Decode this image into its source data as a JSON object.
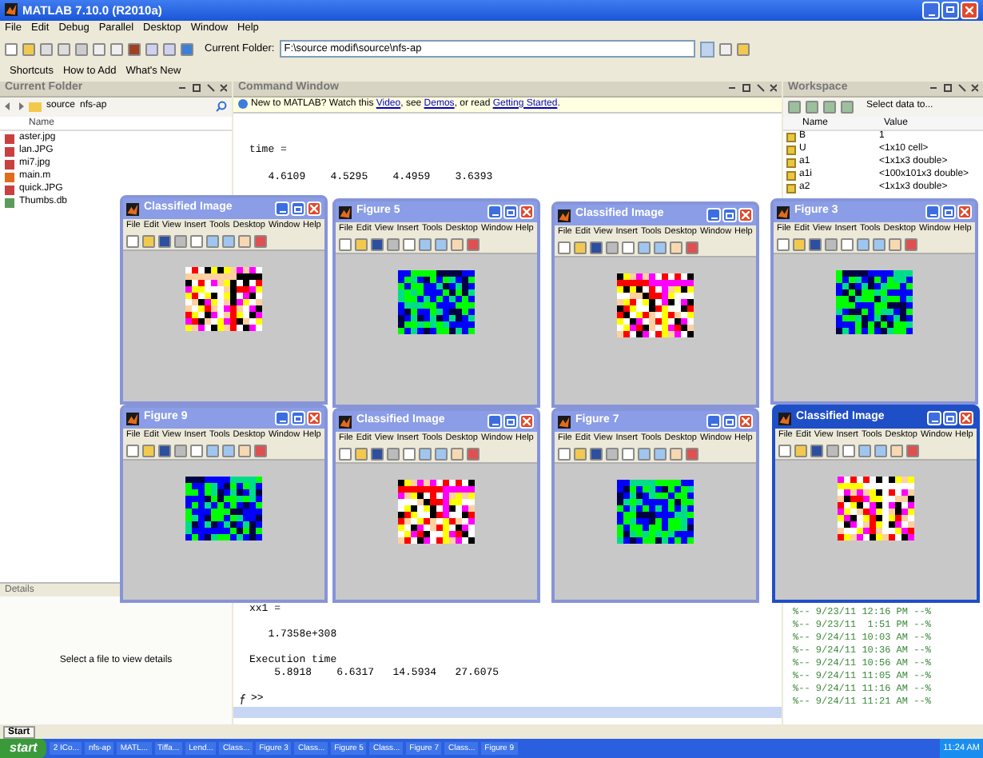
{
  "window": {
    "title": "MATLAB 7.10.0 (R2010a)"
  },
  "menu": [
    "File",
    "Edit",
    "Debug",
    "Parallel",
    "Desktop",
    "Window",
    "Help"
  ],
  "toolbar": {
    "folder_label": "Current Folder:",
    "folder_path": "F:\\source modif\\source\\nfs-ap"
  },
  "shortcuts": {
    "label": "Shortcuts",
    "links": [
      "How to Add",
      "What's New"
    ]
  },
  "current_folder": {
    "title": "Current Folder",
    "path": [
      "source",
      "nfs-ap"
    ],
    "column": "Name",
    "files": [
      {
        "name": "aster.jpg",
        "kind": "image"
      },
      {
        "name": "lan.JPG",
        "kind": "image"
      },
      {
        "name": "mi7.jpg",
        "kind": "image"
      },
      {
        "name": "main.m",
        "kind": "script"
      },
      {
        "name": "quick.JPG",
        "kind": "image"
      },
      {
        "name": "Thumbs.db",
        "kind": "db"
      }
    ],
    "details_title": "Details",
    "details_text": "Select a file to view details"
  },
  "command_window": {
    "title": "Command Window",
    "notice": [
      {
        "text": "New to MATLAB? Watch this ",
        "link": false
      },
      {
        "text": "Video",
        "link": true
      },
      {
        "text": ", see ",
        "link": false
      },
      {
        "text": "Demos",
        "link": true
      },
      {
        "text": ", or read ",
        "link": false
      },
      {
        "text": "Getting Started",
        "link": true
      },
      {
        "text": ".",
        "link": false
      }
    ],
    "lines_top": [
      "time =",
      "   4.6109    4.5295    4.4959    3.6393"
    ],
    "lines_bottom": [
      "xx1 =",
      "   1.7358e+308",
      "Execution time",
      "    5.8918    6.6317   14.5934   27.6075"
    ],
    "prompt": ">>"
  },
  "workspace": {
    "title": "Workspace",
    "select_label": "Select data to...",
    "columns": [
      "Name",
      "Value"
    ],
    "rows": [
      {
        "name": "B",
        "value": "1"
      },
      {
        "name": "U",
        "value": "<1x10 cell>"
      },
      {
        "name": "a1",
        "value": "<1x1x3 double>"
      },
      {
        "name": "a1i",
        "value": "<100x101x3 double>"
      },
      {
        "name": "a2",
        "value": "<1x1x3 double>"
      }
    ]
  },
  "command_history": [
    "%-- 9/23/11 12:16 PM --%",
    "%-- 9/23/11  1:51 PM --%",
    "%-- 9/24/11 10:03 AM --%",
    "%-- 9/24/11 10:36 AM --%",
    "%-- 9/24/11 10:56 AM --%",
    "%-- 9/24/11 11:05 AM --%",
    "%-- 9/24/11 11:16 AM --%",
    "%-- 9/24/11 11:21 AM --%"
  ],
  "figures": [
    {
      "title": "Classified Image",
      "kind": "multicolor",
      "selected": false,
      "menu": [
        "File",
        "Edit",
        "View",
        "Insert",
        "Tools",
        "Desktop",
        "Window",
        "Help"
      ]
    },
    {
      "title": "Figure 5",
      "kind": "greenblue",
      "selected": false,
      "menu": [
        "File",
        "Edit",
        "View",
        "Insert",
        "Tools",
        "Desktop",
        "Window",
        "Help"
      ]
    },
    {
      "title": "Classified Image",
      "kind": "multicolor",
      "selected": false,
      "menu": [
        "File",
        "Edit",
        "View",
        "Insert",
        "Tools",
        "Desktop",
        "Window",
        "Help"
      ]
    },
    {
      "title": "Figure 3",
      "kind": "greenblue",
      "selected": false,
      "menu": [
        "File",
        "Edit",
        "View",
        "Insert",
        "Tools",
        "Desktop",
        "Window",
        "Help"
      ]
    },
    {
      "title": "Figure 9",
      "kind": "greenblue",
      "selected": false,
      "menu": [
        "File",
        "Edit",
        "View",
        "Insert",
        "Tools",
        "Desktop",
        "Window",
        "Help"
      ]
    },
    {
      "title": "Classified Image",
      "kind": "multicolor",
      "selected": false,
      "menu": [
        "File",
        "Edit",
        "View",
        "Insert",
        "Tools",
        "Desktop",
        "Window",
        "Help"
      ]
    },
    {
      "title": "Figure 7",
      "kind": "greenblue",
      "selected": false,
      "menu": [
        "File",
        "Edit",
        "View",
        "Insert",
        "Tools",
        "Desktop",
        "Window",
        "Help"
      ]
    },
    {
      "title": "Classified Image",
      "kind": "multicolor",
      "selected": true,
      "menu": [
        "File",
        "Edit",
        "View",
        "Insert",
        "Tools",
        "Desktop",
        "Window",
        "Help"
      ]
    }
  ],
  "start_button": "Start",
  "taskbar": {
    "start": "start",
    "buttons": [
      "2 ICo...",
      "nfs-ap",
      "MATL...",
      "Tiffa...",
      "Lend...",
      "Class...",
      "Figure 3",
      "Class...",
      "Figure 5",
      "Class...",
      "Figure 7",
      "Class...",
      "Figure 9"
    ],
    "clock": "11:24 AM"
  }
}
